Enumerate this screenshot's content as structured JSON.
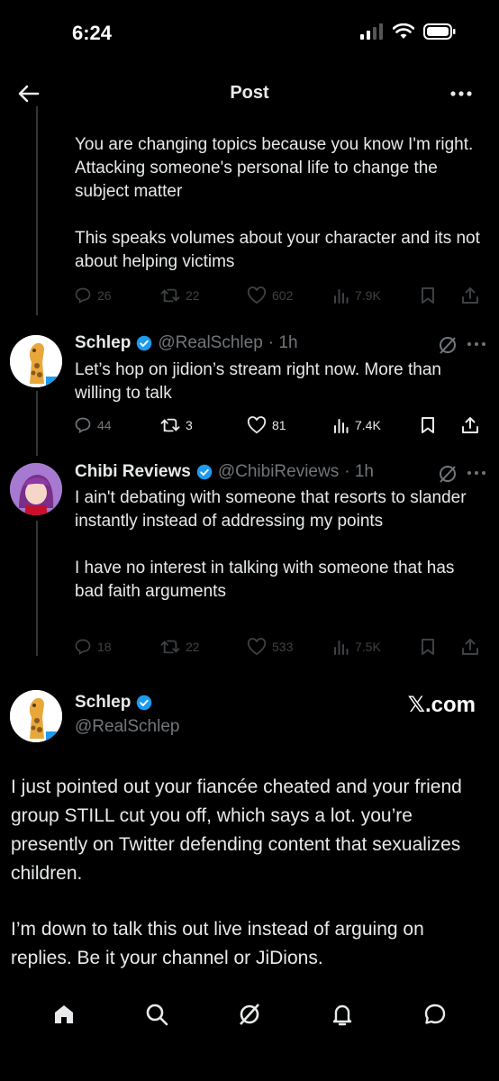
{
  "status": {
    "time": "6:24"
  },
  "header": {
    "title": "Post"
  },
  "reply1": {
    "paragraph1": "You are changing topics because you know I'm right. Attacking someone's personal life to change the subject matter",
    "paragraph2": "This speaks volumes about your character and its not about helping victims",
    "replies": "26",
    "reposts": "22",
    "likes": "602",
    "views": "7.9K"
  },
  "reply2": {
    "name": "Schlep",
    "handle": "@RealSchlep",
    "time": "· 1h",
    "text": "Let’s hop on jidion’s stream right now. More than willing to talk",
    "replies": "44",
    "reposts": "3",
    "likes": "81",
    "views": "7.4K"
  },
  "reply3": {
    "name": "Chibi Reviews",
    "handle": "@ChibiReviews",
    "time": "· 1h",
    "paragraph1": "I ain't debating with someone that resorts to slander instantly instead of addressing my points",
    "paragraph2": "I have no interest in talking with someone that has bad faith arguments",
    "replies": "18",
    "reposts": "22",
    "likes": "533",
    "views": "7.5K"
  },
  "main": {
    "name": "Schlep",
    "handle": "@RealSchlep",
    "watermark": "𝕏.com",
    "paragraph1": "I just pointed out your fiancée cheated and your friend group STILL cut you off, which says a lot. you’re presently on Twitter defending content that sexualizes children.",
    "paragraph2": "I’m down to talk this out live instead of arguing on replies. Be it your channel or JiDions."
  },
  "colors": {
    "accent": "#1d9bf0",
    "background": "#000000",
    "text": "#e7e9ea",
    "muted": "#71767b"
  }
}
